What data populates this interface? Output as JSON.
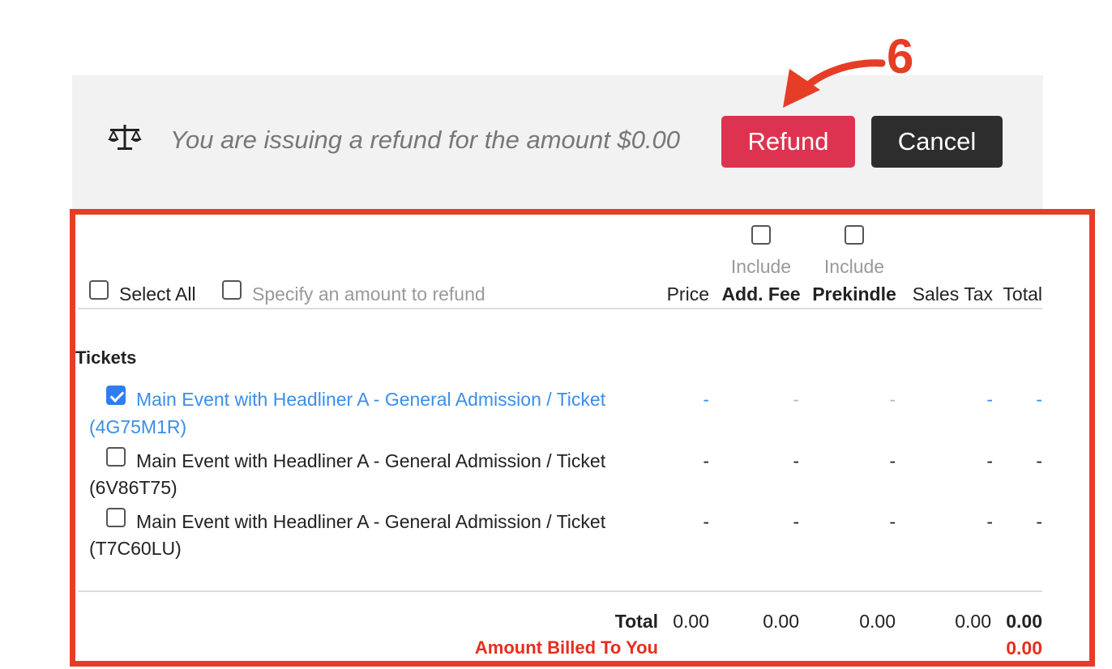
{
  "refund_bar": {
    "message": "You are issuing a refund for the amount $0.00",
    "refund_label": "Refund",
    "cancel_label": "Cancel"
  },
  "annotation": {
    "step": "6"
  },
  "table": {
    "select_all_label": "Select All",
    "specify_amount_label": "Specify an amount to refund",
    "include_label": "Include",
    "columns": {
      "price": "Price",
      "add_fee": "Add. Fee",
      "prekindle": "Prekindle",
      "sales_tax": "Sales Tax",
      "total": "Total"
    },
    "section_title": "Tickets",
    "rows": [
      {
        "line1": "Main Event with Headliner A - General Admission / Ticket",
        "line2": "(4G75M1R)",
        "checked": true,
        "price": "-",
        "add_fee": "-",
        "prekindle": "-",
        "sales_tax": "-",
        "total": "-"
      },
      {
        "line1": "Main Event with Headliner A - General Admission / Ticket",
        "line2": "(6V86T75)",
        "checked": false,
        "price": "-",
        "add_fee": "-",
        "prekindle": "-",
        "sales_tax": "-",
        "total": "-"
      },
      {
        "line1": "Main Event with Headliner A - General Admission / Ticket",
        "line2": "(T7C60LU)",
        "checked": false,
        "price": "-",
        "add_fee": "-",
        "prekindle": "-",
        "sales_tax": "-",
        "total": "-"
      }
    ],
    "totals": {
      "label": "Total",
      "price": "0.00",
      "add_fee": "0.00",
      "prekindle": "0.00",
      "sales_tax": "0.00",
      "total": "0.00"
    },
    "billed": {
      "label": "Amount Billed To You",
      "value": "0.00"
    }
  },
  "colors": {
    "refund": "#de3350",
    "cancel": "#2d2d2d",
    "annotation": "#e63d26",
    "link": "#3a8eea"
  },
  "icons": {
    "scale": "balance-scale-icon"
  }
}
